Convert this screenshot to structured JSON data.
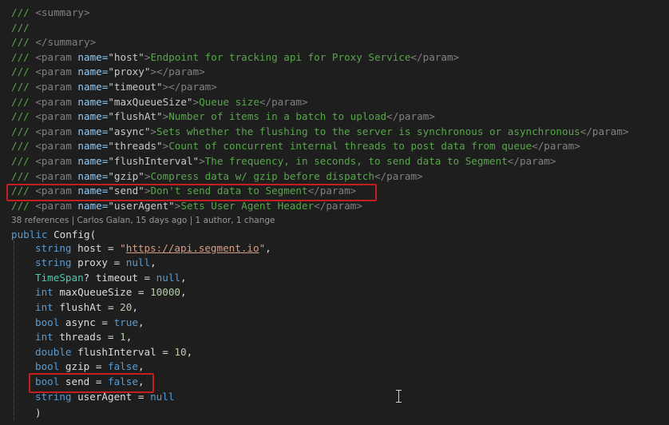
{
  "doc": {
    "slash": "///",
    "summary_open": "<summary>",
    "summary_close": "</summary>",
    "param_open": "<param ",
    "name_attr": "name=",
    "param_close": "</param>",
    "params": [
      {
        "name": "\"host\"",
        "text": ">Endpoint for tracking api for Proxy Service"
      },
      {
        "name": "\"proxy\"",
        "text": "></param>"
      },
      {
        "name": "\"timeout\"",
        "text": "></param>"
      },
      {
        "name": "\"maxQueueSize\"",
        "text": ">Queue size"
      },
      {
        "name": "\"flushAt\"",
        "text": ">Number of items in a batch to upload"
      },
      {
        "name": "\"async\"",
        "text": ">Sets whether the flushing to the server is synchronous or asynchronous"
      },
      {
        "name": "\"threads\"",
        "text": ">Count of concurrent internal threads to post data from queue"
      },
      {
        "name": "\"flushInterval\"",
        "text": ">The frequency, in seconds, to send data to Segment"
      },
      {
        "name": "\"gzip\"",
        "text": ">Compress data w/ gzip before dispatch"
      },
      {
        "name": "\"send\"",
        "text": ">Don't send data to Segment"
      },
      {
        "name": "\"userAgent\"",
        "text": ">Sets User Agent Header"
      }
    ]
  },
  "codelens": "38 references | Carlos Galan, 15 days ago | 1 author, 1 change",
  "code": {
    "sig_kw": "public",
    "sig_name": " Config(",
    "url": "https://api.segment.io",
    "lines": [
      {
        "type": "string",
        "rest": " host = ",
        "val": "\"",
        "val2": "\",",
        "kind": "url"
      },
      {
        "type": "string",
        "rest": " proxy = ",
        "val": "null",
        "tail": ",",
        "kind": "kw"
      },
      {
        "type": "TimeSpan?",
        "rest": " timeout = ",
        "val": "null",
        "tail": ",",
        "kind": "kw"
      },
      {
        "type": "int",
        "rest": " maxQueueSize = ",
        "val": "10000",
        "tail": ",",
        "kind": "num"
      },
      {
        "type": "int",
        "rest": " flushAt = ",
        "val": "20",
        "tail": ",",
        "kind": "num"
      },
      {
        "type": "bool",
        "rest": " async = ",
        "val": "true",
        "tail": ",",
        "kind": "kw"
      },
      {
        "type": "int",
        "rest": " threads = ",
        "val": "1",
        "tail": ",",
        "kind": "num"
      },
      {
        "type": "double",
        "rest": " flushInterval = ",
        "val": "10",
        "tail": ",",
        "kind": "num"
      },
      {
        "type": "bool",
        "rest": " gzip = ",
        "val": "false",
        "tail": ",",
        "kind": "kw"
      },
      {
        "type": "bool",
        "rest": " send = ",
        "val": "false",
        "tail": ",",
        "kind": "kw"
      },
      {
        "type": "string",
        "rest": " userAgent = ",
        "val": "null",
        "tail": "",
        "kind": "kw"
      }
    ],
    "close": ")"
  },
  "colors": {
    "highlight_box": "#c41e1e",
    "background": "#1e1e1e"
  }
}
